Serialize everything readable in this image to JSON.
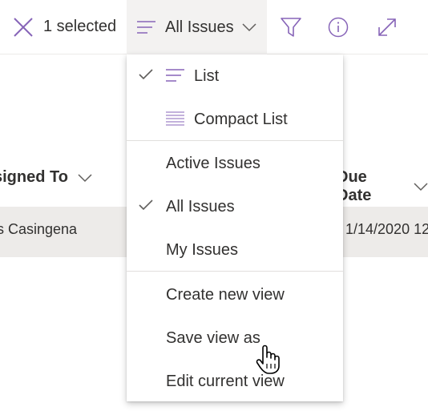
{
  "command_bar": {
    "selected_count_label": "1 selected",
    "view_label": "All Issues",
    "icons": {
      "close": "close-icon",
      "view": "list-view-icon",
      "view_chevron": "chevron-down-icon",
      "filter": "filter-icon",
      "info": "info-icon",
      "expand": "expand-icon"
    }
  },
  "list": {
    "columns": [
      {
        "label": "signed To"
      },
      {
        "label": "Due Date"
      }
    ],
    "rows": [
      {
        "assigned_to": "is Casingena",
        "due_date": "1/14/2020 12"
      }
    ]
  },
  "view_menu": {
    "groups": [
      {
        "items": [
          {
            "label": "List",
            "icon": "list-icon",
            "checked": true
          },
          {
            "label": "Compact List",
            "icon": "compact-list-icon",
            "checked": false
          }
        ]
      },
      {
        "items": [
          {
            "label": "Active Issues",
            "checked": false
          },
          {
            "label": "All Issues",
            "checked": true
          },
          {
            "label": "My Issues",
            "checked": false
          }
        ]
      },
      {
        "items": [
          {
            "label": "Create new view",
            "checked": false
          },
          {
            "label": "Save view as",
            "checked": false
          },
          {
            "label": "Edit current view",
            "checked": false
          }
        ]
      }
    ]
  },
  "colors": {
    "accent": "#8764b8",
    "selected_row": "#edebe9",
    "button_active": "#f3f2f1",
    "text": "#323130"
  }
}
